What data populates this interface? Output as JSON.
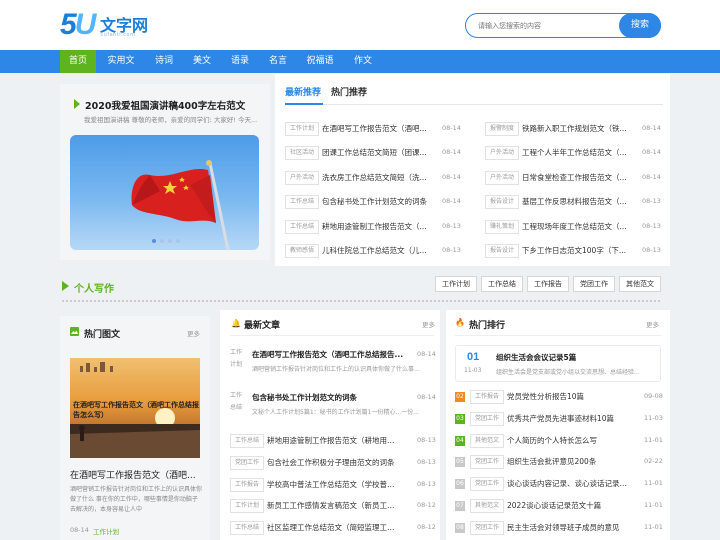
{
  "logo": {
    "mark": "5U",
    "name": "文字网",
    "sub": "5ufanti.com"
  },
  "search": {
    "placeholder": "请输入您搜索的内容",
    "button": "搜索"
  },
  "nav": [
    "首页",
    "实用文",
    "诗词",
    "美文",
    "语录",
    "名言",
    "祝福语",
    "作文"
  ],
  "featured": {
    "title": "2020我爱祖国演讲稿400字左右范文",
    "summary": "我爱祖国演讲稿 尊敬的老师，亲爱的同学们: 大家好! 今天..."
  },
  "tabs": [
    "最新推荐",
    "热门推荐"
  ],
  "recommend_left": [
    {
      "tag": "工作计划",
      "title": "在酒吧写工作报告范文（酒吧...",
      "date": "08-14"
    },
    {
      "tag": "社区活动",
      "title": "团课工作总结范文简短（团课...",
      "date": "08-14"
    },
    {
      "tag": "户外活动",
      "title": "洗衣房工作总结范文简短（洗...",
      "date": "08-14"
    },
    {
      "tag": "工作总结",
      "title": "包含秘书处工作计划范文的词条",
      "date": "08-14"
    },
    {
      "tag": "工作总结",
      "title": "耕地用途管制工作报告范文（...",
      "date": "08-13"
    },
    {
      "tag": "教师感悟",
      "title": "儿科住院总工作总结范文（儿...",
      "date": "08-13"
    }
  ],
  "recommend_right": [
    {
      "tag": "报警制度",
      "title": "铁路新入职工作规划范文（铁...",
      "date": "08-14"
    },
    {
      "tag": "户外活动",
      "title": "工程个人半年工作总结范文（...",
      "date": "08-14"
    },
    {
      "tag": "户外活动",
      "title": "日常食堂检查工作报告范文（...",
      "date": "08-14"
    },
    {
      "tag": "报告设计",
      "title": "基层工作反思材料报告范文（...",
      "date": "08-13"
    },
    {
      "tag": "赚礼策划",
      "title": "工程现场年度工作总结范文（...",
      "date": "08-13"
    },
    {
      "tag": "报告设计",
      "title": "下乡工作日志范文100字（下...",
      "date": "08-13"
    }
  ],
  "writing_section": {
    "title": "个人写作",
    "tags": [
      "工作计划",
      "工作总结",
      "工作报告",
      "党团工作",
      "其他范文"
    ]
  },
  "hot_images": {
    "head": "热门图文",
    "more": "更多",
    "image_caption": "在酒吧写工作报告范文（酒吧工作总结报告怎么写）",
    "title": "在酒吧写工作报告范文（酒吧...",
    "desc": "酒吧营销工作报告针对岗位和工作上的认识具体你做了什么 事在你的工作中，哪些事情是你动脑子去解决的，本身容易让人中",
    "date": "08-14",
    "tag": "工作计划"
  },
  "latest": {
    "head": "最新文章",
    "more": "更多",
    "featured": [
      {
        "tag": "工作\n计划",
        "title": "在酒吧写工作报告范文（酒吧工作总结报告...",
        "desc": "酒吧营销工作报告针对岗位和工作上的认识具体你做了什么事...",
        "date": "08-14"
      },
      {
        "tag": "工作\n总结",
        "title": "包含秘书处工作计划范文的词条",
        "desc": "文秘个人工作计划5篇1：秘书的工作计划篇1一份精心...一份...",
        "date": "08-14"
      }
    ],
    "items": [
      {
        "tag": "工作总结",
        "title": "耕地用途管制工作报告范文（耕地用途...",
        "date": "08-13"
      },
      {
        "tag": "党团工作",
        "title": "包含社会工作积极分子理由范文的词条",
        "date": "08-13"
      },
      {
        "tag": "工作报告",
        "title": "学校高中普法工作总结范文（学校普法...",
        "date": "08-13"
      },
      {
        "tag": "工作计划",
        "title": "新员工工作感情发言稿范文（新员工的...",
        "date": "08-12"
      },
      {
        "tag": "工作总结",
        "title": "社区监理工作总结范文（简短监理工作...",
        "date": "08-12"
      }
    ]
  },
  "ranking": {
    "head": "热门排行",
    "more": "更多",
    "top": {
      "num": "01",
      "date": "11-03",
      "title": "组织生活会会议记录5篇",
      "desc": "组织生活会是党支部或党小组以交流思想、总结经验..."
    },
    "items": [
      {
        "rank": "02",
        "tag": "工作报告",
        "title": "党员党性分析报告10篇",
        "date": "09-08"
      },
      {
        "rank": "03",
        "tag": "党团工作",
        "title": "优秀共产党员先进事迹材料10篇",
        "date": "11-03"
      },
      {
        "rank": "04",
        "tag": "其他范文",
        "title": "个人简历的个人特长怎么写",
        "date": "11-01"
      },
      {
        "rank": "05",
        "tag": "党团工作",
        "title": "组织生活会批评意见200条",
        "date": "02-22"
      },
      {
        "rank": "06",
        "tag": "党团工作",
        "title": "谈心谈话内容记录、谈心谈话记录范...",
        "date": "11-01"
      },
      {
        "rank": "07",
        "tag": "其他范文",
        "title": "2022谈心谈话记录范文十篇",
        "date": "11-01"
      },
      {
        "rank": "08",
        "tag": "党团工作",
        "title": "民主生活会对领导班子成员的意见",
        "date": "11-01"
      }
    ]
  },
  "colors": {
    "primary": "#2e86e6",
    "green": "#5fb31f",
    "orange": "#ee8a1e",
    "rank_top": "#f26b3a"
  }
}
